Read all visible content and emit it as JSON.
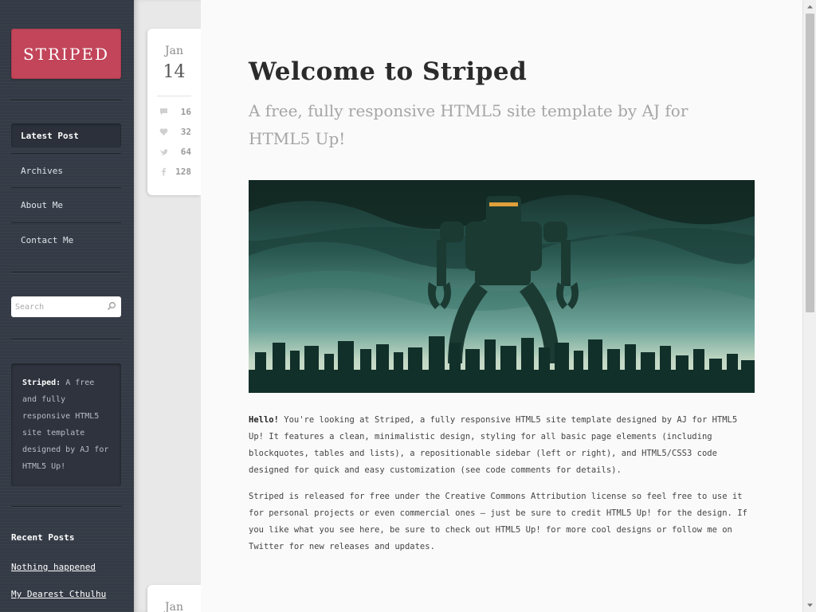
{
  "sidebar": {
    "logo": "STRIPED",
    "nav": [
      {
        "label": "Latest Post",
        "active": true
      },
      {
        "label": "Archives",
        "active": false
      },
      {
        "label": "About Me",
        "active": false
      },
      {
        "label": "Contact Me",
        "active": false
      }
    ],
    "search": {
      "placeholder": "Search"
    },
    "about": {
      "bold": "Striped:",
      "text": "A free and fully responsive HTML5 site template designed by AJ for HTML5 Up!"
    },
    "recent_title": "Recent Posts",
    "recent": [
      "Nothing happened",
      "My Dearest Cthulhu"
    ]
  },
  "post": {
    "month": "Jan",
    "day": "14",
    "stats": [
      {
        "icon": "comment-icon",
        "value": "16"
      },
      {
        "icon": "heart-icon",
        "value": "32"
      },
      {
        "icon": "twitter-icon",
        "value": "64"
      },
      {
        "icon": "facebook-icon",
        "value": "128"
      }
    ],
    "title": "Welcome to Striped",
    "subtitle": "A free, fully responsive HTML5 site template by AJ for HTML5 Up!",
    "image": "giant-robot-over-city-illustration",
    "p1_bold": "Hello!",
    "p1": "You're looking at Striped, a fully responsive HTML5 site template designed by AJ for HTML5 Up! It features a clean, minimalistic design, styling for all basic page elements (including blockquotes, tables and lists), a repositionable sidebar (left or right), and HTML5/CSS3 code designed for quick and easy customization (see code comments for details).",
    "p2": "Striped is released for free under the Creative Commons Attribution license so feel free to use it for personal projects or even commercial ones — just be sure to credit HTML5 Up! for the design. If you like what you see here, be sure to check out HTML5 Up! for more cool designs or follow me on Twitter for new releases and updates."
  },
  "next_post": {
    "month": "Jan"
  },
  "colors": {
    "logo": "#c2455a",
    "sidebar": "#353b46",
    "accent_text": "#a5a5a5"
  }
}
